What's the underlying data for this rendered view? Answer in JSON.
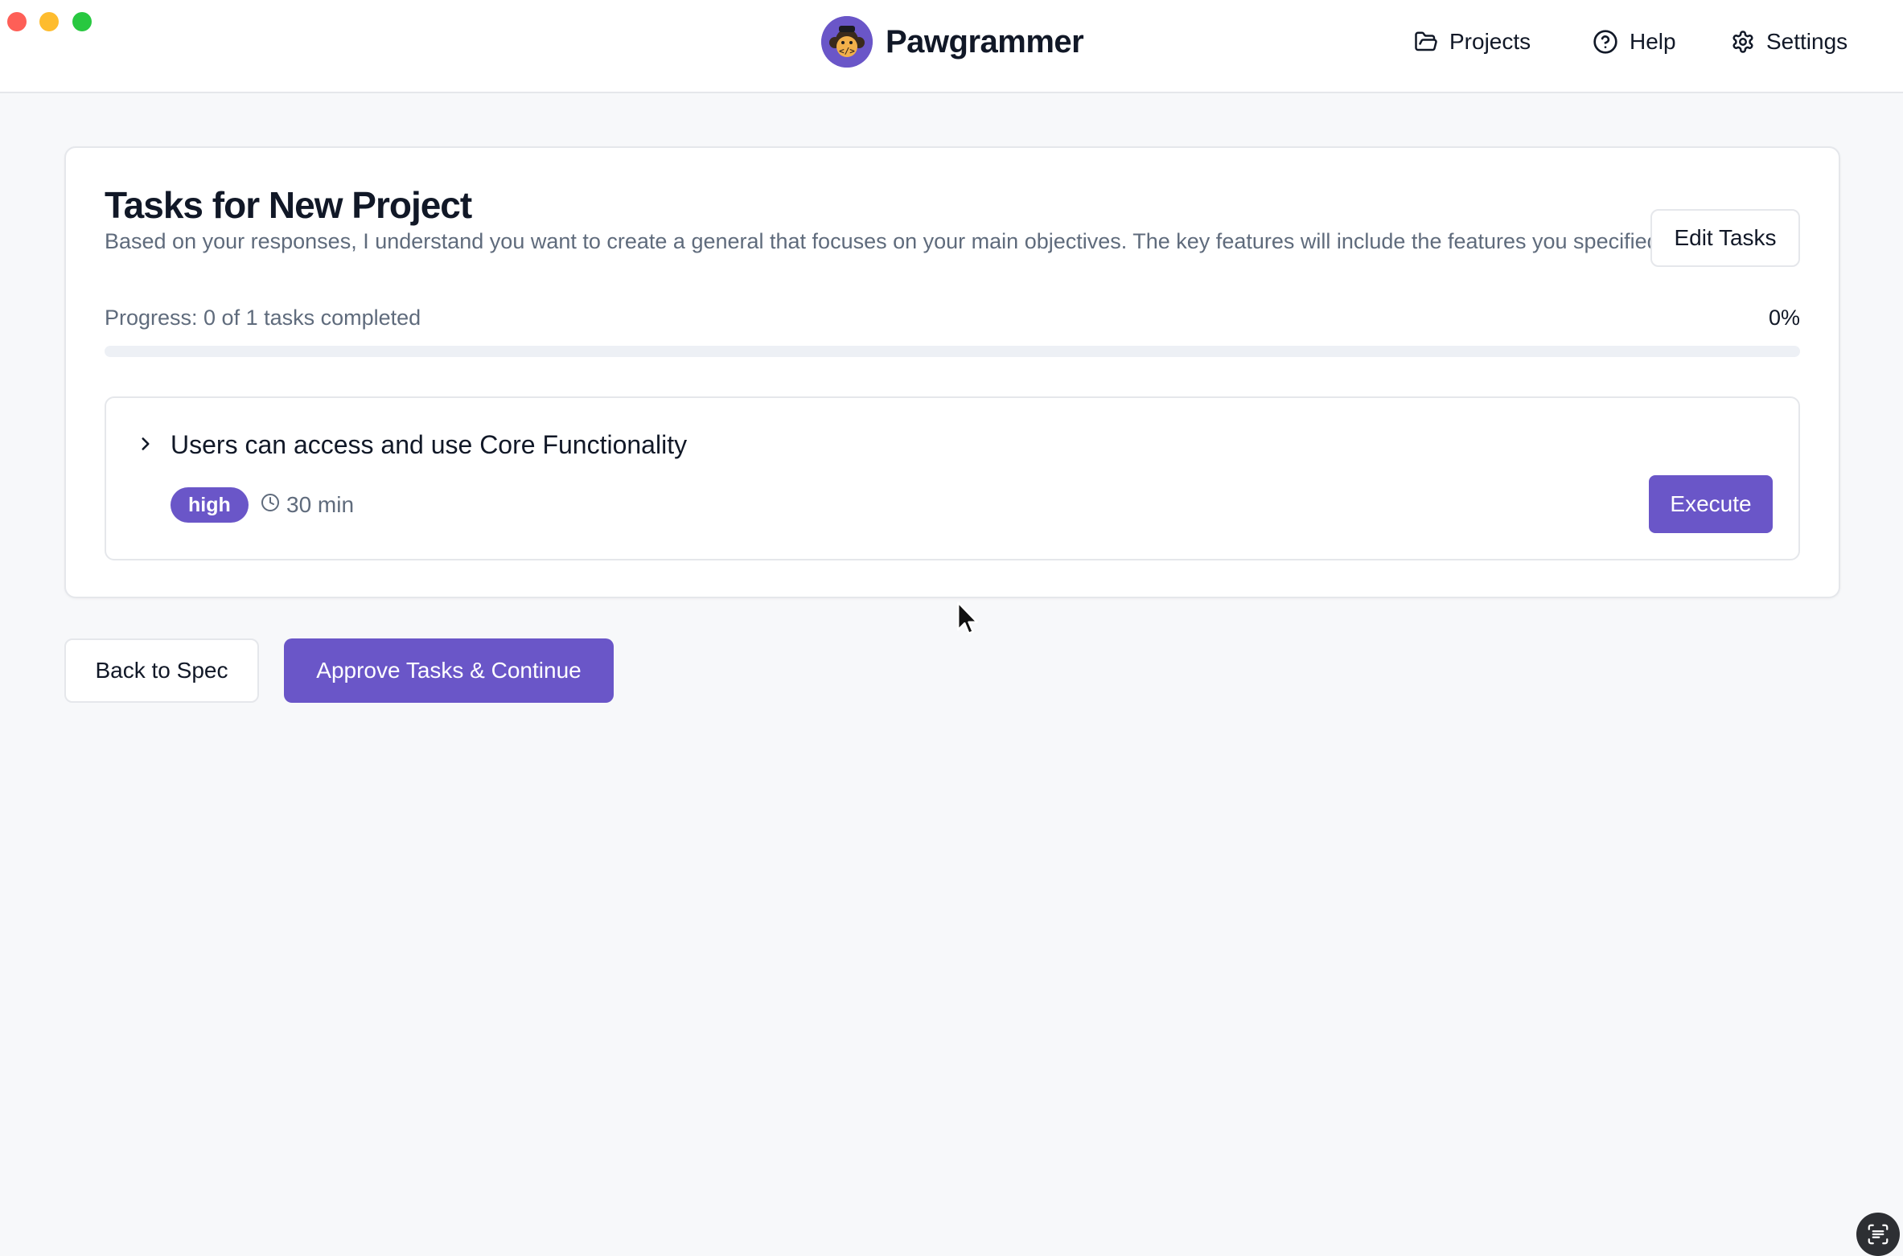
{
  "app": {
    "name": "Pawgrammer"
  },
  "nav": {
    "projects": "Projects",
    "help": "Help",
    "settings": "Settings"
  },
  "card": {
    "title": "Tasks for New Project",
    "description": "Based on your responses, I understand you want to create a general that focuses on your main objectives. The key features will include the features you specified.",
    "edit_button": "Edit Tasks",
    "progress_label": "Progress: 0 of 1 tasks completed",
    "progress_percent": "0%",
    "progress_fraction": 0
  },
  "tasks": [
    {
      "title": "Users can access and use Core Functionality",
      "priority": "high",
      "duration": "30 min",
      "action": "Execute",
      "expanded": false
    }
  ],
  "actions": {
    "back": "Back to Spec",
    "approve": "Approve Tasks & Continue"
  },
  "colors": {
    "accent": "#6a56c8",
    "background": "#f7f8fa",
    "muted_text": "#5f6b7c",
    "border": "#e5e7eb"
  },
  "icons": {
    "logo": "monkey-coder-logo",
    "projects": "folder-open-icon",
    "help": "help-circle-icon",
    "settings": "gear-icon",
    "expand": "chevron-right-icon",
    "duration": "clock-icon",
    "widget": "screen-text-icon"
  }
}
